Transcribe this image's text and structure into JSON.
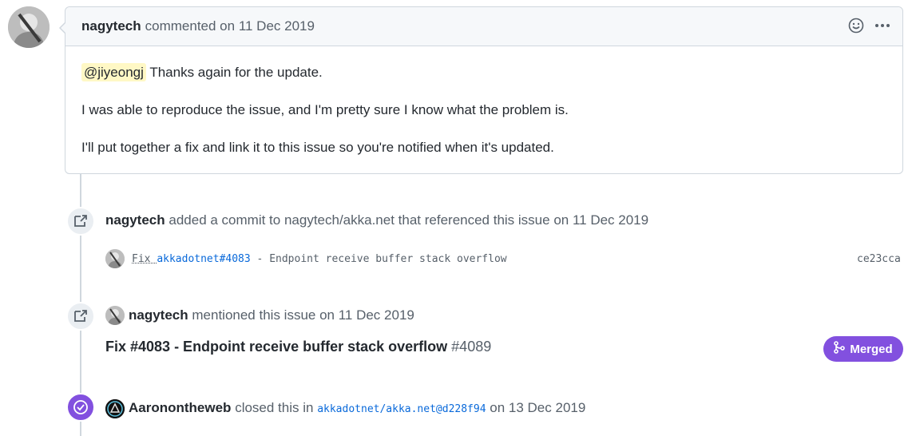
{
  "comment": {
    "author": "nagytech",
    "meta": "commented on 11 Dec 2019",
    "mention": "@jiyeongj",
    "line1_rest": " Thanks again for the update.",
    "line2": "I was able to reproduce the issue, and I'm pretty sure I know what the problem is.",
    "line3": "I'll put together a fix and link it to this issue so you're notified when it's updated."
  },
  "commit_event": {
    "author": "nagytech",
    "text": "added a commit to nagytech/akka.net that referenced this issue on 11 Dec 2019",
    "commit_prefix": "Fix ",
    "commit_ref": "akkadotnet#4083",
    "commit_rest": " - Endpoint receive buffer stack overflow",
    "sha": "ce23cca"
  },
  "mention_event": {
    "author": "nagytech",
    "text": "mentioned this issue on 11 Dec 2019",
    "pr_title": "Fix #4083 - Endpoint receive buffer stack overflow",
    "pr_number": "#4089",
    "status": "Merged"
  },
  "close_event": {
    "author": "Aaronontheweb",
    "text_before": "closed this in",
    "commit_link": "akkadotnet/akka.net@d228f94",
    "text_after": "on 13 Dec 2019"
  },
  "colors": {
    "merged": "#8250df",
    "link": "#0969da",
    "mention_bg": "#fff8c5"
  },
  "icons": [
    "smiley-icon",
    "kebab-horizontal-icon",
    "cross-reference-icon",
    "git-merge-icon",
    "check-circle-icon"
  ]
}
